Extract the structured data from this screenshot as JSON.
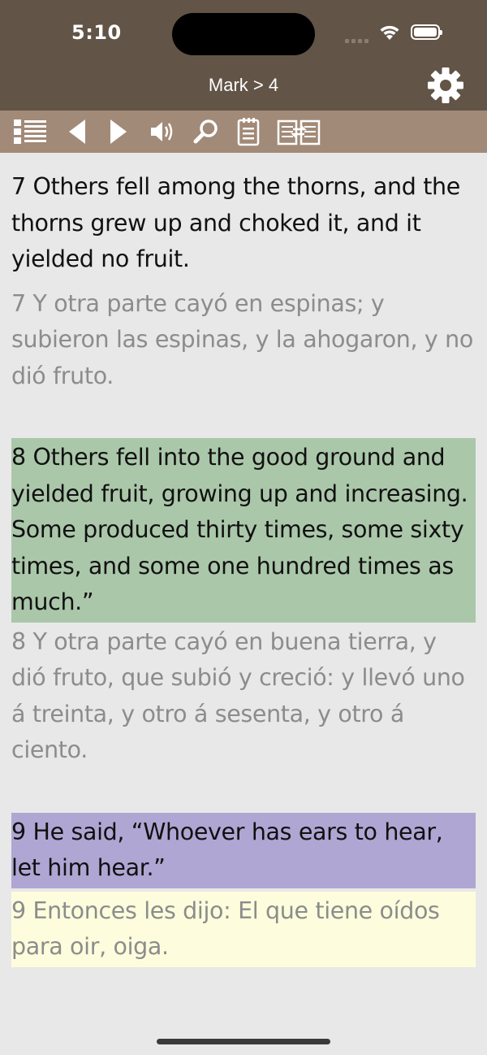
{
  "status_bar": {
    "time": "5:10"
  },
  "nav": {
    "title": "Mark > 4"
  },
  "toolbar": {
    "icons": [
      "list-icon",
      "back-triangle-icon",
      "forward-triangle-icon",
      "speaker-icon",
      "search-icon",
      "notes-icon",
      "compare-icon"
    ]
  },
  "verses": [
    {
      "en": "7  Others fell among the thorns, and the thorns grew up and choked it, and it yielded no fruit.",
      "es": "7  Y otra parte cayó en espinas; y subieron las espinas, y la ahogaron, y no dió fruto.",
      "en_highlight": "",
      "es_highlight": ""
    },
    {
      "en": "8  Others fell into the good ground and yielded fruit, growing up and increasing. Some produced thirty times, some sixty times, and some one hundred times as much.”",
      "es": "8  Y otra parte cayó en buena tierra, y dió fruto, que subió y creció: y llevó uno á treinta, y otro á sesenta, y otro á ciento.",
      "en_highlight": "#abc7aa",
      "es_highlight": ""
    },
    {
      "en": "9  He said, “Whoever has ears to hear, let him hear.”",
      "es": "9  Entonces les dijo: El que tiene oídos para oir, oiga.",
      "en_highlight": "#b0a6d3",
      "es_highlight": "#fdfddd"
    }
  ],
  "colors": {
    "header_bg": "#625447",
    "toolbar_bg": "#a28a78",
    "page_bg": "#e8e8e8"
  }
}
